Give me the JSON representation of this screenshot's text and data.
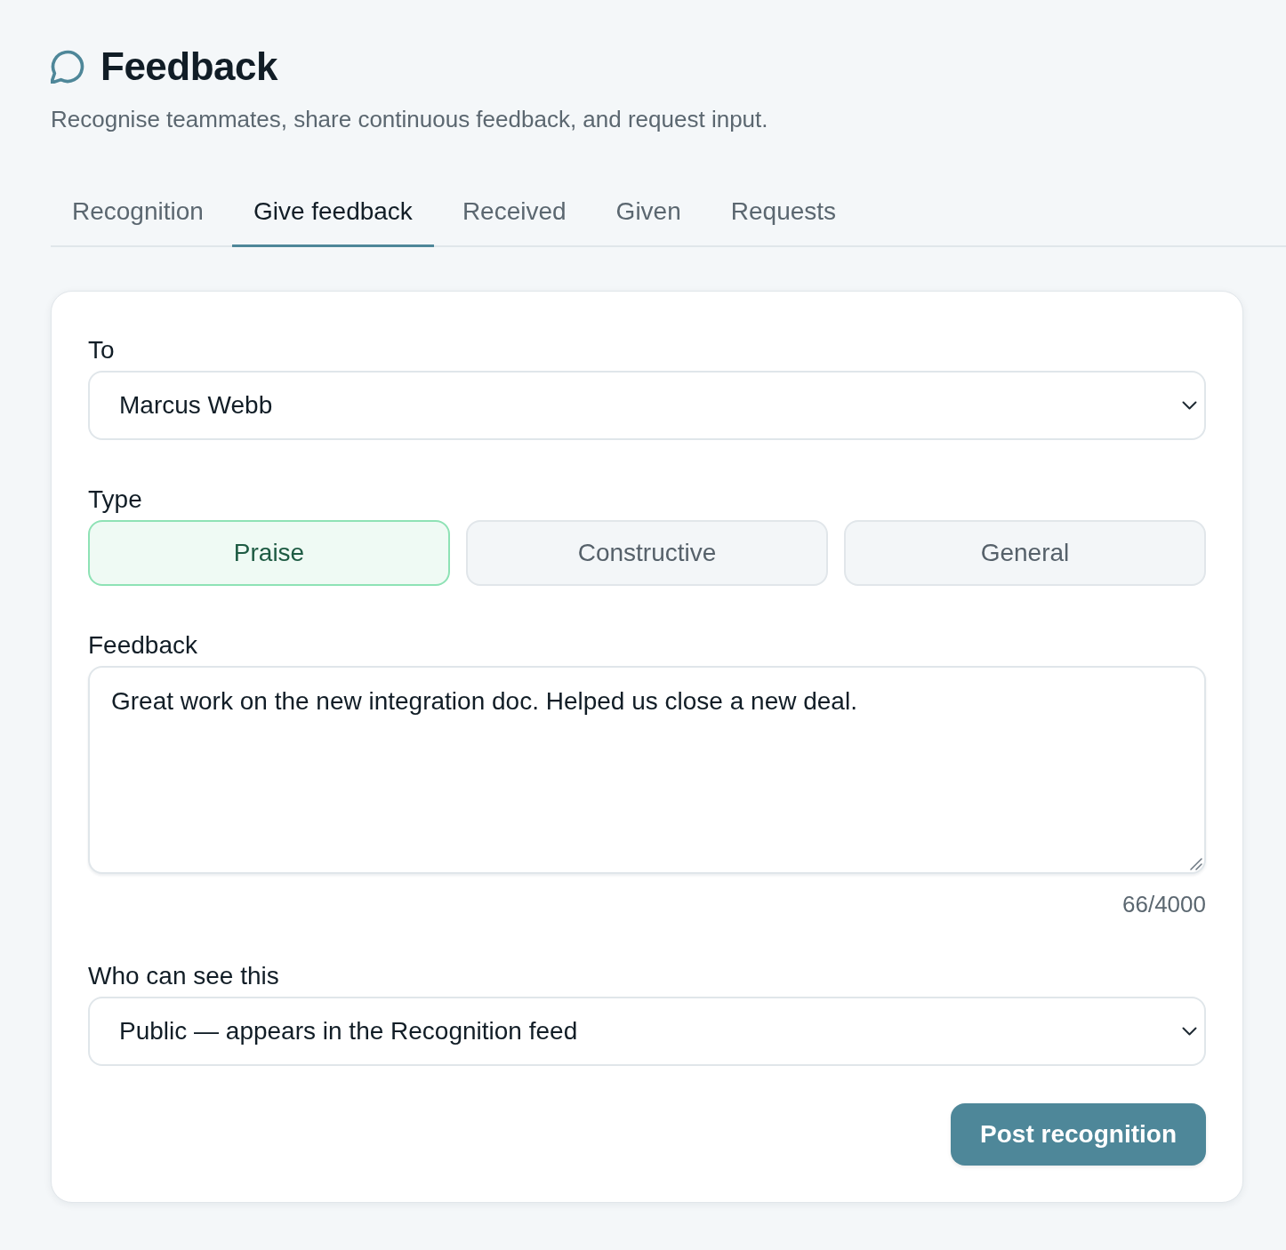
{
  "header": {
    "title": "Feedback",
    "subtitle": "Recognise teammates, share continuous feedback, and request input."
  },
  "tabs": [
    {
      "label": "Recognition",
      "selected": false
    },
    {
      "label": "Give feedback",
      "selected": true
    },
    {
      "label": "Received",
      "selected": false
    },
    {
      "label": "Given",
      "selected": false
    },
    {
      "label": "Requests",
      "selected": false
    }
  ],
  "form": {
    "fields": [
      {
        "kind": "select",
        "label": "To",
        "value": "Marcus Webb"
      },
      {
        "kind": "choice",
        "label": "Type",
        "options": [
          {
            "label": "Praise",
            "selected": true
          },
          {
            "label": "Constructive",
            "selected": false
          },
          {
            "label": "General",
            "selected": false
          }
        ]
      },
      {
        "kind": "textarea",
        "label": "Feedback",
        "value": "Great work on the new integration doc. Helped us close a new deal.",
        "counter": "66/4000"
      },
      {
        "kind": "select",
        "label": "Who can see this",
        "value": "Public — appears in the Recognition feed"
      }
    ],
    "submit_button": "Post recognition"
  }
}
